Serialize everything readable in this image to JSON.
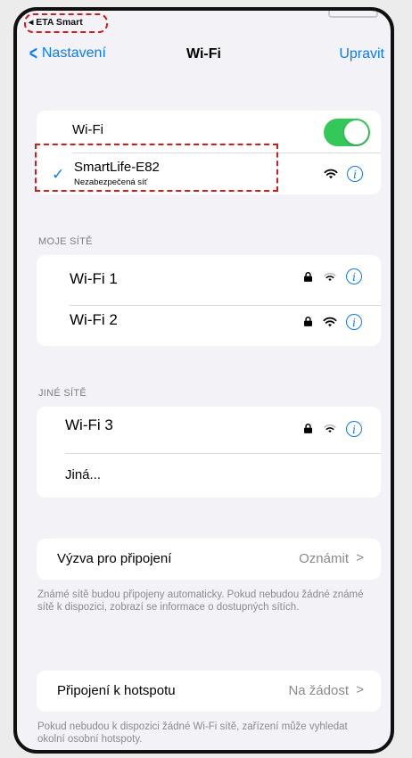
{
  "status": {
    "back_label": "◂ ETA Smart"
  },
  "nav": {
    "back_label": "Nastavení",
    "title": "Wi-Fi",
    "edit_label": "Upravit"
  },
  "wifi_group": {
    "toggle_label": "Wi-Fi",
    "toggle_on": true,
    "connected": {
      "name": "SmartLife-E82",
      "subtitle": "Nezabezpečená síť"
    }
  },
  "my_networks": {
    "header": "MOJE SÍTĚ",
    "items": [
      {
        "name": "Wi-Fi 1"
      },
      {
        "name": "Wi-Fi 2"
      }
    ]
  },
  "other_networks": {
    "header": "JINÉ SÍTĚ",
    "items": [
      {
        "name": "Wi-Fi 3"
      }
    ],
    "other_label": "Jiná..."
  },
  "ask_join": {
    "label": "Výzva pro připojení",
    "value": "Oznámit",
    "footer": "Známé sítě budou připojeny automaticky. Pokud nebudou žádné známé sítě k dispozici, zobrazí se informace o dostupných sítích."
  },
  "hotspot": {
    "label": "Připojení k hotspotu",
    "value": "Na žádost",
    "footer": "Pokud nebudou k dispozici žádné Wi-Fi sítě, zařízení může vyhledat okolní osobní hotspoty."
  },
  "colors": {
    "accent": "#0a7aff",
    "toggle_on": "#34c759",
    "highlight": "#d21c1c"
  }
}
